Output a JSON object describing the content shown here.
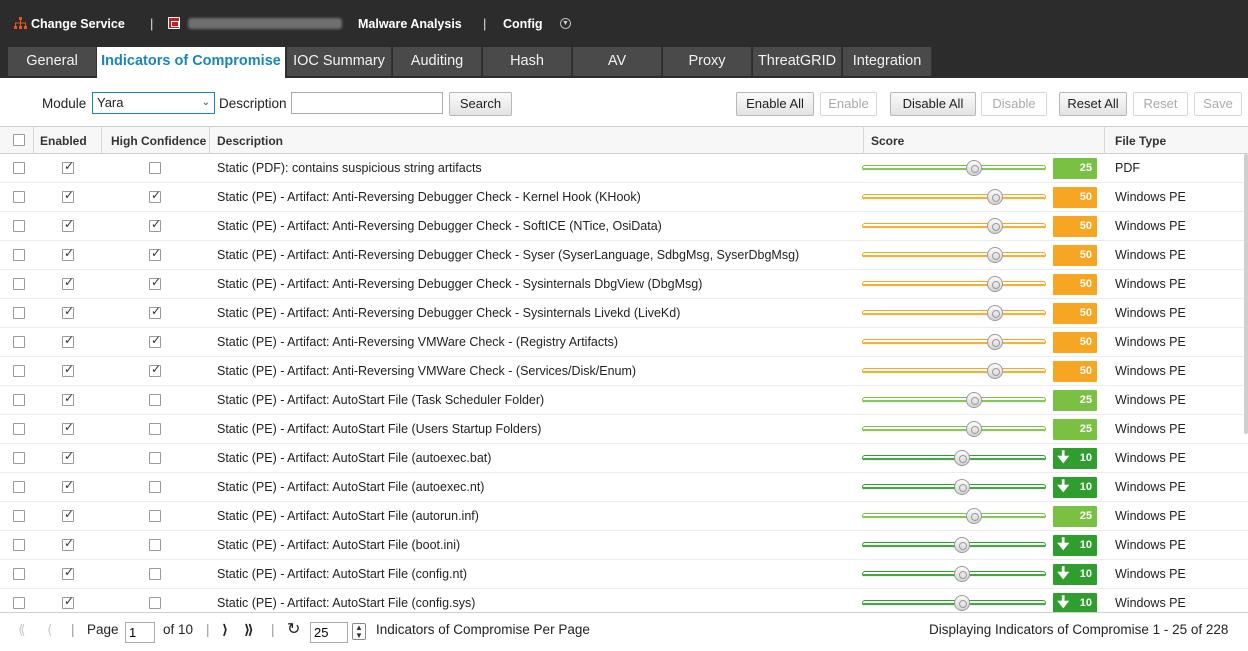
{
  "topbar": {
    "change_service": "Change Service",
    "service_name": "Malware Analysis",
    "config": "Config"
  },
  "tabs": [
    {
      "label": "General",
      "active": false
    },
    {
      "label": "Indicators of Compromise",
      "active": true
    },
    {
      "label": "IOC Summary",
      "active": false
    },
    {
      "label": "Auditing",
      "active": false
    },
    {
      "label": "Hash",
      "active": false
    },
    {
      "label": "AV",
      "active": false
    },
    {
      "label": "Proxy",
      "active": false
    },
    {
      "label": "ThreatGRID",
      "active": false
    },
    {
      "label": "Integration",
      "active": false
    }
  ],
  "toolbar": {
    "module_label": "Module",
    "module_value": "Yara",
    "description_label": "Description",
    "description_value": "",
    "search": "Search",
    "enable_all": "Enable All",
    "enable": "Enable",
    "disable_all": "Disable All",
    "disable": "Disable",
    "reset_all": "Reset All",
    "reset": "Reset",
    "save": "Save"
  },
  "columns": {
    "enabled": "Enabled",
    "high_confidence": "High Confidence",
    "description": "Description",
    "score": "Score",
    "file_type": "File Type"
  },
  "colors": {
    "accent": "#1a85b8",
    "score_green_light": "#7ac143",
    "score_orange": "#f6a623",
    "score_green_dark": "#2f9e2f",
    "topbar": "#2c2c2c"
  },
  "rows": [
    {
      "selected": false,
      "enabled": true,
      "high_confidence": false,
      "description": "Static (PDF): contains suspicious string artifacts",
      "score": 25,
      "file_type": "PDF"
    },
    {
      "selected": false,
      "enabled": true,
      "high_confidence": true,
      "description": "Static (PE) - Artifact: Anti-Reversing Debugger Check - Kernel Hook (KHook)",
      "score": 50,
      "file_type": "Windows PE"
    },
    {
      "selected": false,
      "enabled": true,
      "high_confidence": true,
      "description": "Static (PE) - Artifact: Anti-Reversing Debugger Check - SoftICE (NTice, OsiData)",
      "score": 50,
      "file_type": "Windows PE"
    },
    {
      "selected": false,
      "enabled": true,
      "high_confidence": true,
      "description": "Static (PE) - Artifact: Anti-Reversing Debugger Check - Syser (SyserLanguage, SdbgMsg, SyserDbgMsg)",
      "score": 50,
      "file_type": "Windows PE"
    },
    {
      "selected": false,
      "enabled": true,
      "high_confidence": true,
      "description": "Static (PE) - Artifact: Anti-Reversing Debugger Check - Sysinternals DbgView (DbgMsg)",
      "score": 50,
      "file_type": "Windows PE"
    },
    {
      "selected": false,
      "enabled": true,
      "high_confidence": true,
      "description": "Static (PE) - Artifact: Anti-Reversing Debugger Check - Sysinternals Livekd (LiveKd)",
      "score": 50,
      "file_type": "Windows PE"
    },
    {
      "selected": false,
      "enabled": true,
      "high_confidence": true,
      "description": "Static (PE) - Artifact: Anti-Reversing VMWare Check - (Registry Artifacts)",
      "score": 50,
      "file_type": "Windows PE"
    },
    {
      "selected": false,
      "enabled": true,
      "high_confidence": true,
      "description": "Static (PE) - Artifact: Anti-Reversing VMWare Check - (Services/Disk/Enum)",
      "score": 50,
      "file_type": "Windows PE"
    },
    {
      "selected": false,
      "enabled": true,
      "high_confidence": false,
      "description": "Static (PE) - Artifact: AutoStart File (Task Scheduler Folder)",
      "score": 25,
      "file_type": "Windows PE"
    },
    {
      "selected": false,
      "enabled": true,
      "high_confidence": false,
      "description": "Static (PE) - Artifact: AutoStart File (Users Startup Folders)",
      "score": 25,
      "file_type": "Windows PE"
    },
    {
      "selected": false,
      "enabled": true,
      "high_confidence": false,
      "description": "Static (PE) - Artifact: AutoStart File (autoexec.bat)",
      "score": 10,
      "file_type": "Windows PE"
    },
    {
      "selected": false,
      "enabled": true,
      "high_confidence": false,
      "description": "Static (PE) - Artifact: AutoStart File (autoexec.nt)",
      "score": 10,
      "file_type": "Windows PE"
    },
    {
      "selected": false,
      "enabled": true,
      "high_confidence": false,
      "description": "Static (PE) - Artifact: AutoStart File (autorun.inf)",
      "score": 25,
      "file_type": "Windows PE"
    },
    {
      "selected": false,
      "enabled": true,
      "high_confidence": false,
      "description": "Static (PE) - Artifact: AutoStart File (boot.ini)",
      "score": 10,
      "file_type": "Windows PE"
    },
    {
      "selected": false,
      "enabled": true,
      "high_confidence": false,
      "description": "Static (PE) - Artifact: AutoStart File (config.nt)",
      "score": 10,
      "file_type": "Windows PE"
    },
    {
      "selected": false,
      "enabled": true,
      "high_confidence": false,
      "description": "Static (PE) - Artifact: AutoStart File (config.sys)",
      "score": 10,
      "file_type": "Windows PE"
    }
  ],
  "pager": {
    "page_label": "Page",
    "page_value": "1",
    "of_label": "of 10",
    "per_page_value": "25",
    "per_page_label": "Indicators of Compromise Per Page",
    "status": "Displaying Indicators of Compromise 1 - 25 of 228"
  }
}
